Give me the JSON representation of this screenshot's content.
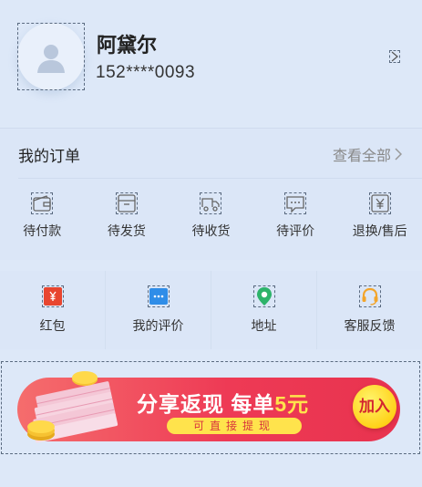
{
  "user": {
    "name": "阿黛尔",
    "phone": "152****0093"
  },
  "orders": {
    "title": "我的订单",
    "view_all": "查看全部",
    "items": [
      {
        "label": "待付款",
        "icon": "wallet-icon"
      },
      {
        "label": "待发货",
        "icon": "package-icon"
      },
      {
        "label": "待收货",
        "icon": "delivery-truck-icon"
      },
      {
        "label": "待评价",
        "icon": "comment-icon"
      },
      {
        "label": "退换/售后",
        "icon": "refund-icon"
      }
    ]
  },
  "services": [
    {
      "label": "红包",
      "icon": "red-packet-icon",
      "color": "#e8452f"
    },
    {
      "label": "我的评价",
      "icon": "chat-bubble-icon",
      "color": "#2f8de8"
    },
    {
      "label": "地址",
      "icon": "location-pin-icon",
      "color": "#2db36a"
    },
    {
      "label": "客服反馈",
      "icon": "headset-icon",
      "color": "#f3a52b"
    }
  ],
  "banner": {
    "title_main": "分享返现 每单",
    "title_highlight": "5元",
    "subtitle": "可直接提现",
    "button": "加入"
  }
}
